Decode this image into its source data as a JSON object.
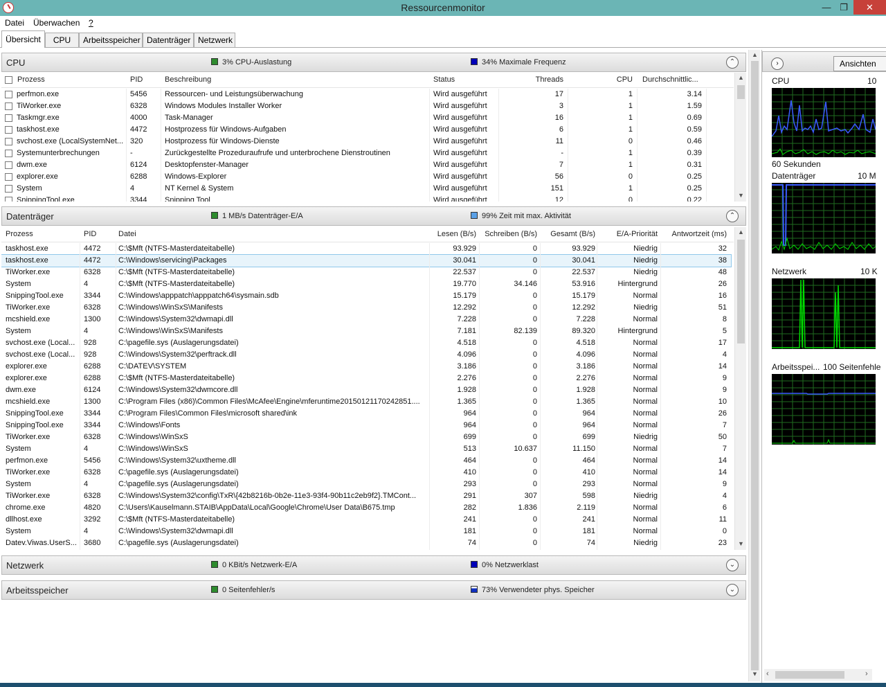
{
  "window": {
    "title": "Ressourcenmonitor"
  },
  "menu": [
    "Datei",
    "Überwachen",
    "?"
  ],
  "tabs": [
    "Übersicht",
    "CPU",
    "Arbeitsspeicher",
    "Datenträger",
    "Netzwerk"
  ],
  "cpu_section": {
    "title": "CPU",
    "stat1": "3% CPU-Auslastung",
    "stat2": "34% Maximale Frequenz",
    "columns": [
      "Prozess",
      "PID",
      "Beschreibung",
      "Status",
      "Threads",
      "CPU",
      "Durchschnittlic..."
    ],
    "rows": [
      [
        "perfmon.exe",
        "5456",
        "Ressourcen- und Leistungsüberwachung",
        "Wird ausgeführt",
        "17",
        "1",
        "3.14"
      ],
      [
        "TiWorker.exe",
        "6328",
        "Windows Modules Installer Worker",
        "Wird ausgeführt",
        "3",
        "1",
        "1.59"
      ],
      [
        "Taskmgr.exe",
        "4000",
        "Task-Manager",
        "Wird ausgeführt",
        "16",
        "1",
        "0.69"
      ],
      [
        "taskhost.exe",
        "4472",
        "Hostprozess für Windows-Aufgaben",
        "Wird ausgeführt",
        "6",
        "1",
        "0.59"
      ],
      [
        "svchost.exe (LocalSystemNet...",
        "320",
        "Hostprozess für Windows-Dienste",
        "Wird ausgeführt",
        "11",
        "0",
        "0.46"
      ],
      [
        "Systemunterbrechungen",
        "-",
        "Zurückgestellte Prozeduraufrufe und unterbrochene Dienstroutinen",
        "Wird ausgeführt",
        "-",
        "1",
        "0.39"
      ],
      [
        "dwm.exe",
        "6124",
        "Desktopfenster-Manager",
        "Wird ausgeführt",
        "7",
        "1",
        "0.31"
      ],
      [
        "explorer.exe",
        "6288",
        "Windows-Explorer",
        "Wird ausgeführt",
        "56",
        "0",
        "0.25"
      ],
      [
        "System",
        "4",
        "NT Kernel & System",
        "Wird ausgeführt",
        "151",
        "1",
        "0.25"
      ],
      [
        "SnippingTool.exe",
        "3344",
        "Snipping Tool",
        "Wird ausgeführt",
        "12",
        "0",
        "0.22"
      ]
    ]
  },
  "disk_section": {
    "title": "Datenträger",
    "stat1": "1 MB/s Datenträger-E/A",
    "stat2": "99% Zeit mit max. Aktivität",
    "columns": [
      "Prozess",
      "PID",
      "Datei",
      "Lesen (B/s)",
      "Schreiben (B/s)",
      "Gesamt (B/s)",
      "E/A-Priorität",
      "Antwortzeit (ms)"
    ],
    "rows": [
      [
        "taskhost.exe",
        "4472",
        "C:\\$Mft (NTFS-Masterdateitabelle)",
        "93.929",
        "0",
        "93.929",
        "Niedrig",
        "32"
      ],
      [
        "taskhost.exe",
        "4472",
        "C:\\Windows\\servicing\\Packages",
        "30.041",
        "0",
        "30.041",
        "Niedrig",
        "38"
      ],
      [
        "TiWorker.exe",
        "6328",
        "C:\\$Mft (NTFS-Masterdateitabelle)",
        "22.537",
        "0",
        "22.537",
        "Niedrig",
        "48"
      ],
      [
        "System",
        "4",
        "C:\\$Mft (NTFS-Masterdateitabelle)",
        "19.770",
        "34.146",
        "53.916",
        "Hintergrund",
        "26"
      ],
      [
        "SnippingTool.exe",
        "3344",
        "C:\\Windows\\apppatch\\apppatch64\\sysmain.sdb",
        "15.179",
        "0",
        "15.179",
        "Normal",
        "16"
      ],
      [
        "TiWorker.exe",
        "6328",
        "C:\\Windows\\WinSxS\\Manifests",
        "12.292",
        "0",
        "12.292",
        "Niedrig",
        "51"
      ],
      [
        "mcshield.exe",
        "1300",
        "C:\\Windows\\System32\\dwmapi.dll",
        "7.228",
        "0",
        "7.228",
        "Normal",
        "8"
      ],
      [
        "System",
        "4",
        "C:\\Windows\\WinSxS\\Manifests",
        "7.181",
        "82.139",
        "89.320",
        "Hintergrund",
        "5"
      ],
      [
        "svchost.exe (Local...",
        "928",
        "C:\\pagefile.sys (Auslagerungsdatei)",
        "4.518",
        "0",
        "4.518",
        "Normal",
        "17"
      ],
      [
        "svchost.exe (Local...",
        "928",
        "C:\\Windows\\System32\\perftrack.dll",
        "4.096",
        "0",
        "4.096",
        "Normal",
        "4"
      ],
      [
        "explorer.exe",
        "6288",
        "C:\\DATEV\\SYSTEM",
        "3.186",
        "0",
        "3.186",
        "Normal",
        "14"
      ],
      [
        "explorer.exe",
        "6288",
        "C:\\$Mft (NTFS-Masterdateitabelle)",
        "2.276",
        "0",
        "2.276",
        "Normal",
        "9"
      ],
      [
        "dwm.exe",
        "6124",
        "C:\\Windows\\System32\\dwmcore.dll",
        "1.928",
        "0",
        "1.928",
        "Normal",
        "9"
      ],
      [
        "mcshield.exe",
        "1300",
        "C:\\Program Files (x86)\\Common Files\\McAfee\\Engine\\mferuntime20150121170242851....",
        "1.365",
        "0",
        "1.365",
        "Normal",
        "10"
      ],
      [
        "SnippingTool.exe",
        "3344",
        "C:\\Program Files\\Common Files\\microsoft shared\\ink",
        "964",
        "0",
        "964",
        "Normal",
        "26"
      ],
      [
        "SnippingTool.exe",
        "3344",
        "C:\\Windows\\Fonts",
        "964",
        "0",
        "964",
        "Normal",
        "7"
      ],
      [
        "TiWorker.exe",
        "6328",
        "C:\\Windows\\WinSxS",
        "699",
        "0",
        "699",
        "Niedrig",
        "50"
      ],
      [
        "System",
        "4",
        "C:\\Windows\\WinSxS",
        "513",
        "10.637",
        "11.150",
        "Normal",
        "7"
      ],
      [
        "perfmon.exe",
        "5456",
        "C:\\Windows\\System32\\uxtheme.dll",
        "464",
        "0",
        "464",
        "Normal",
        "14"
      ],
      [
        "TiWorker.exe",
        "6328",
        "C:\\pagefile.sys (Auslagerungsdatei)",
        "410",
        "0",
        "410",
        "Normal",
        "14"
      ],
      [
        "System",
        "4",
        "C:\\pagefile.sys (Auslagerungsdatei)",
        "293",
        "0",
        "293",
        "Normal",
        "9"
      ],
      [
        "TiWorker.exe",
        "6328",
        "C:\\Windows\\System32\\config\\TxR\\{42b8216b-0b2e-11e3-93f4-90b11c2eb9f2}.TMCont...",
        "291",
        "307",
        "598",
        "Niedrig",
        "4"
      ],
      [
        "chrome.exe",
        "4820",
        "C:\\Users\\Kauselmann.STAIB\\AppData\\Local\\Google\\Chrome\\User Data\\B675.tmp",
        "282",
        "1.836",
        "2.119",
        "Normal",
        "6"
      ],
      [
        "dllhost.exe",
        "3292",
        "C:\\$Mft (NTFS-Masterdateitabelle)",
        "241",
        "0",
        "241",
        "Normal",
        "11"
      ],
      [
        "System",
        "4",
        "C:\\Windows\\System32\\dwmapi.dll",
        "181",
        "0",
        "181",
        "Normal",
        "0"
      ],
      [
        "Datev.Viwas.UserS...",
        "3680",
        "C:\\pagefile.sys (Auslagerungsdatei)",
        "74",
        "0",
        "74",
        "Niedrig",
        "23"
      ]
    ]
  },
  "network_section": {
    "title": "Netzwerk",
    "stat1": "0 KBit/s Netzwerk-E/A",
    "stat2": "0% Netzwerklast"
  },
  "memory_section": {
    "title": "Arbeitsspeicher",
    "stat1": "0 Seitenfehler/s",
    "stat2": "73% Verwendeter phys. Speicher"
  },
  "right_panel": {
    "view_button": "Ansichten",
    "graphs": [
      {
        "label": "CPU",
        "value": "10",
        "footer": "60 Sekunden"
      },
      {
        "label": "Datenträger",
        "value": "10 M"
      },
      {
        "label": "Netzwerk",
        "value": "10 K"
      },
      {
        "label": "Arbeitsspei...",
        "value": "100 Seitenfehle"
      }
    ]
  },
  "colors": {
    "titlebar": "#6bb5b5",
    "graph_green": "#00ff00",
    "graph_blue": "#3a5bff",
    "close": "#c7413a"
  }
}
